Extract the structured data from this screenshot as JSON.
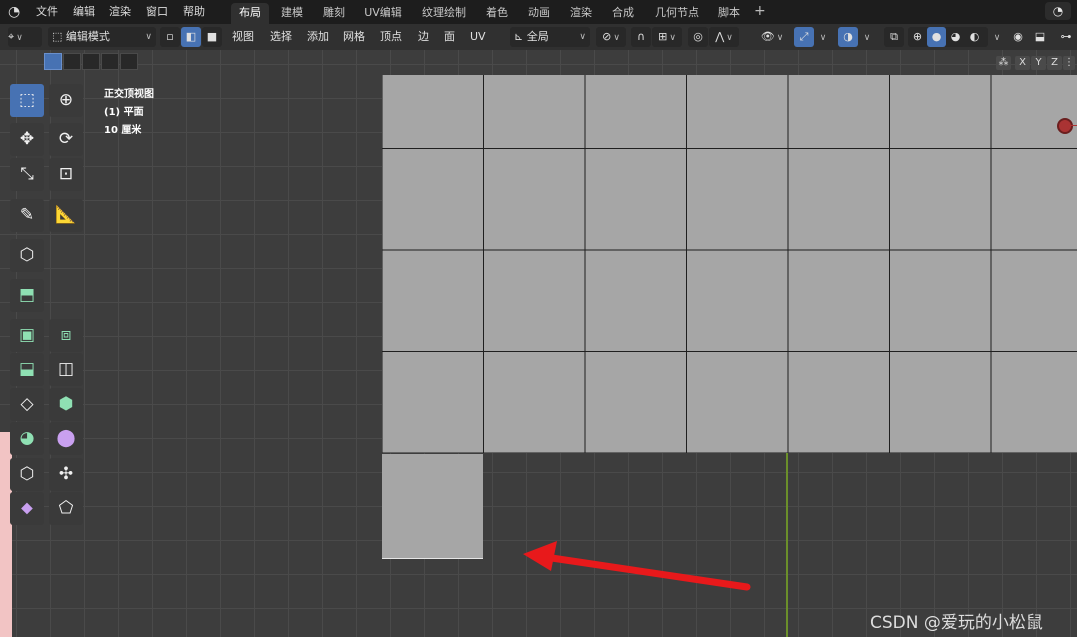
{
  "menu": {
    "logo": "blender-logo",
    "items": [
      "文件",
      "编辑",
      "渲染",
      "窗口",
      "帮助"
    ]
  },
  "workspaces": [
    "布局",
    "建模",
    "雕刻",
    "UV编辑",
    "纹理绘制",
    "着色",
    "动画",
    "渲染",
    "合成",
    "几何节点",
    "脚本"
  ],
  "active_workspace": "布局",
  "header": {
    "mode": "编辑模式",
    "menus": [
      "视图",
      "选择",
      "添加",
      "网格",
      "顶点",
      "边",
      "面",
      "UV"
    ],
    "transform_orientation": "全局"
  },
  "viewport": {
    "view_name": "正交顶视图",
    "object_info": "(1) 平面",
    "grid_scale": "10 厘米"
  },
  "gizmo_axes": [
    "X",
    "Y",
    "Z"
  ],
  "watermark": "CSDN @爱玩的小松鼠",
  "colors": {
    "active": "#4772b3",
    "plane": "#a6a6a6",
    "annotation": "#e8191b",
    "y_axis": "#6b8f2a"
  }
}
